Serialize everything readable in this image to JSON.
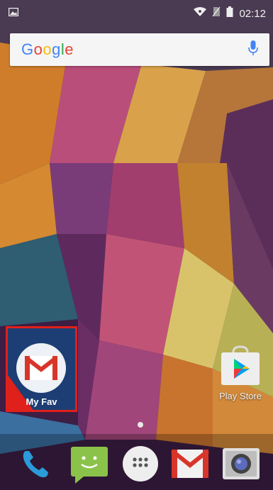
{
  "status_bar": {
    "time": "02:12",
    "icons": [
      "gallery-notification-icon",
      "wifi-icon",
      "no-sim-icon",
      "battery-icon"
    ]
  },
  "search": {
    "logo": [
      "G",
      "o",
      "o",
      "g",
      "l",
      "e"
    ],
    "mic_icon": "mic-icon"
  },
  "home": {
    "highlighted_app": {
      "label": "My Fav",
      "icon": "gmail-icon",
      "highlight_color": "#e0201a"
    },
    "apps": [
      {
        "label": "Play Store",
        "icon": "play-store-icon"
      }
    ]
  },
  "dock": {
    "items": [
      "phone-icon",
      "messaging-icon",
      "app-drawer-icon",
      "gmail-icon",
      "camera-icon"
    ]
  },
  "colors": {
    "accent": "#e0201a",
    "wallpaper_dark": "#4a1a4a"
  }
}
